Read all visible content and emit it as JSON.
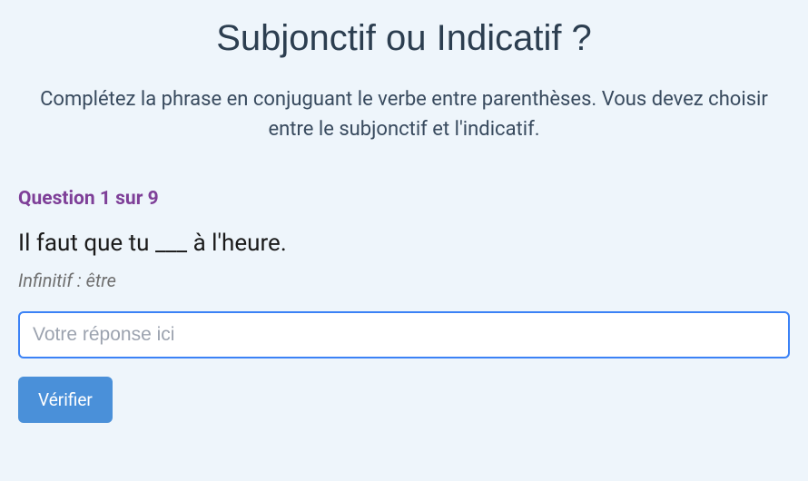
{
  "title": "Subjonctif ou Indicatif ?",
  "instructions": "Complétez la phrase en conjuguant le verbe entre parenthèses. Vous devez choisir entre le subjonctif et l'indicatif.",
  "question": {
    "label": "Question 1 sur 9",
    "sentence": "Il faut que tu ___ à l'heure.",
    "infinitive": "Infinitif : être"
  },
  "input": {
    "placeholder": "Votre réponse ici",
    "value": ""
  },
  "button": {
    "verify": "Vérifier"
  }
}
